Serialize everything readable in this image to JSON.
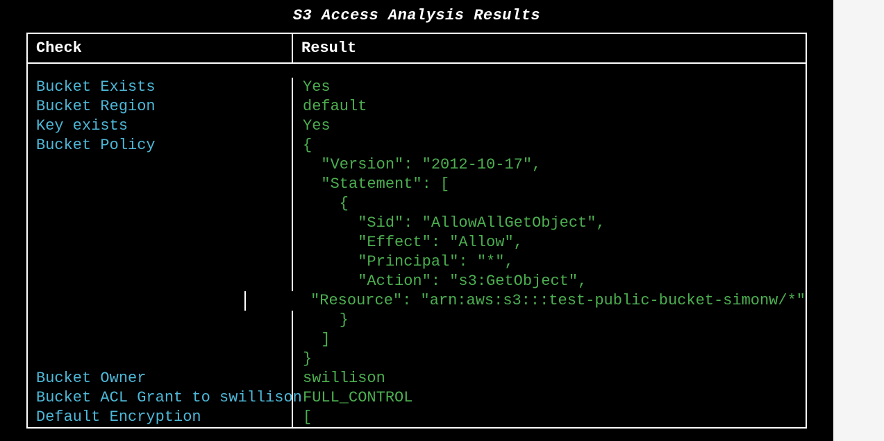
{
  "title": "S3 Access Analysis Results",
  "headers": {
    "check": "Check",
    "result": "Result"
  },
  "rows": [
    {
      "check": "Bucket Exists",
      "result": "Yes"
    },
    {
      "check": "Bucket Region",
      "result": "default"
    },
    {
      "check": "Key exists",
      "result": "Yes"
    },
    {
      "check": "Bucket Policy",
      "result": "{"
    },
    {
      "check": "",
      "result": "  \"Version\": \"2012-10-17\","
    },
    {
      "check": "",
      "result": "  \"Statement\": ["
    },
    {
      "check": "",
      "result": "    {"
    },
    {
      "check": "",
      "result": "      \"Sid\": \"AllowAllGetObject\","
    },
    {
      "check": "",
      "result": "      \"Effect\": \"Allow\","
    },
    {
      "check": "",
      "result": "      \"Principal\": \"*\","
    },
    {
      "check": "",
      "result": "      \"Action\": \"s3:GetObject\","
    },
    {
      "check": "",
      "result": "      \"Resource\": \"arn:aws:s3:::test-public-bucket-simonw/*\""
    },
    {
      "check": "",
      "result": "    }"
    },
    {
      "check": "",
      "result": "  ]"
    },
    {
      "check": "",
      "result": "}"
    },
    {
      "check": "Bucket Owner",
      "result": "swillison"
    },
    {
      "check": "Bucket ACL Grant to swillison",
      "result": "FULL_CONTROL"
    },
    {
      "check": "Default Encryption",
      "result": "["
    }
  ]
}
